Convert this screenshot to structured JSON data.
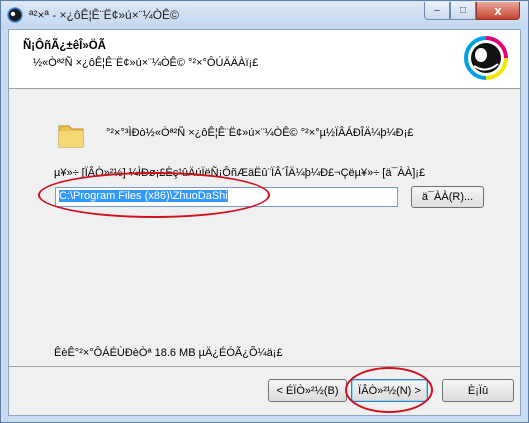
{
  "window": {
    "title": "ª²×ª - ×¿ôÊ¦Ê¨Ë¢»ú×¨¼ÒÊ©",
    "minimize_glyph": "–",
    "maximize_glyph": "□",
    "close_glyph": "x"
  },
  "header": {
    "title": "Ñ¡ÔñÃ¿±êÎ»ÖÃ",
    "subtitle": "½«Òª²Ñ ×¿ôÊ¦Ê¨Ë¢»ú×¨¼ÒÊ© °²×°ÔÚÄÄÀï¡£"
  },
  "body": {
    "intro": "°²×°³ÌÐò½«Òª²Ñ ×¿ôÊ¦Ê¨Ë¢»ú×¨¼ÒÊ© °²×°µ½ÏÂÁÐÎÄ¼þ¼Ð¡£",
    "description": "µ¥»÷ [ÏÂÒ»²½] ¼ÌÐø¡£Èç¹ûÄúÏëÑ¡ÔñÆäËû¨ÏÂ´ÎÄ¼þ¼Ð£¬Çëµ¥»÷ [ä¯ÀÀ]¡£",
    "install_path": "C:\\Program Files (x86)\\ZhuoDaShi",
    "browse_label": "ä¯ÀÀ(R)...",
    "space_required": "ÊèÊ°²×°ÔÁÉÙÐèÒª 18.6 MB µÄ¿ÉÓÃ¿Õ¼ä¡£"
  },
  "buttons": {
    "back": "< ÉÏÒ»²½(B)",
    "next": "ÏÂÒ»²½(N) >",
    "cancel": "È¡Ïû"
  },
  "colors": {
    "annotation_red": "#d0101d",
    "selection_blue": "#3399ff"
  }
}
